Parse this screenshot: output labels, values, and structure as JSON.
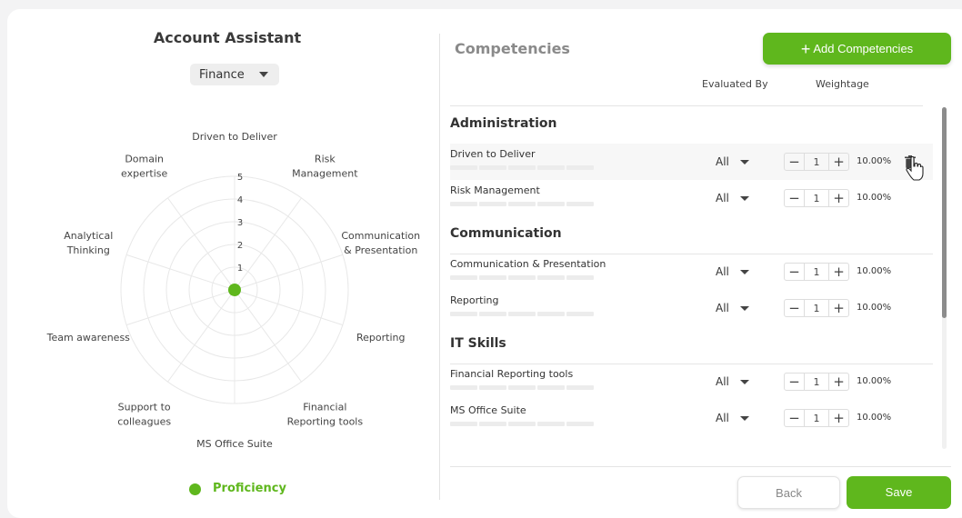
{
  "role": {
    "title": "Account Assistant",
    "department": "Finance"
  },
  "radar": {
    "axes": [
      "Driven to Deliver",
      "Risk Management",
      "Communication & Presentation",
      "Reporting",
      "Financial Reporting tools",
      "MS Office Suite",
      "Support to colleagues",
      "Team awareness",
      "Analytical Thinking",
      "Domain expertise"
    ],
    "scale": [
      "1",
      "2",
      "3",
      "4",
      "5"
    ],
    "max": 5,
    "series": {
      "name": "Proficiency",
      "values": [
        0,
        0,
        0,
        0,
        0,
        0,
        0,
        0,
        0,
        0
      ],
      "color": "#5fb71d"
    }
  },
  "competencies": {
    "title": "Competencies",
    "add_label": "Add Competencies",
    "col_evaluated": "Evaluated By",
    "col_weightage": "Weightage",
    "groups": [
      {
        "name": "Administration",
        "items": [
          {
            "name": "Driven to Deliver",
            "evaluated_by": "All",
            "weight": "1",
            "percent": "10.00%"
          },
          {
            "name": "Risk Management",
            "evaluated_by": "All",
            "weight": "1",
            "percent": "10.00%"
          }
        ]
      },
      {
        "name": "Communication",
        "items": [
          {
            "name": "Communication & Presentation",
            "evaluated_by": "All",
            "weight": "1",
            "percent": "10.00%"
          },
          {
            "name": "Reporting",
            "evaluated_by": "All",
            "weight": "1",
            "percent": "10.00%"
          }
        ]
      },
      {
        "name": "IT Skills",
        "items": [
          {
            "name": "Financial Reporting tools",
            "evaluated_by": "All",
            "weight": "1",
            "percent": "10.00%"
          },
          {
            "name": "MS Office Suite",
            "evaluated_by": "All",
            "weight": "1",
            "percent": "10.00%"
          }
        ]
      }
    ]
  },
  "footer": {
    "back_label": "Back",
    "save_label": "Save"
  },
  "colors": {
    "accent": "#5fb71d"
  }
}
